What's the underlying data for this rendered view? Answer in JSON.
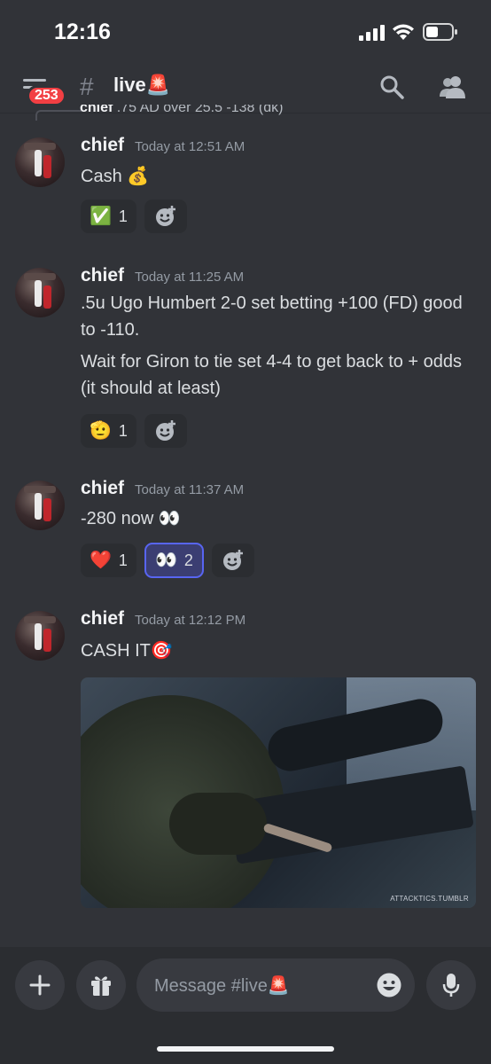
{
  "status_bar": {
    "time": "12:16"
  },
  "header": {
    "unread_badge": "253",
    "channel_name": "live🚨"
  },
  "reply_preview": {
    "author": "chief",
    "text": ".75 AD over 25.5 -138 (dk)"
  },
  "messages": [
    {
      "author": "chief",
      "timestamp": "Today at 12:51 AM",
      "lines": [
        "Cash 💰"
      ],
      "reactions": [
        {
          "emoji": "✅",
          "count": "1",
          "active": false
        }
      ]
    },
    {
      "author": "chief",
      "timestamp": "Today at 11:25 AM",
      "lines": [
        ".5u Ugo Humbert 2-0 set betting +100 (FD) good to -110.",
        "Wait for Giron to tie set 4-4 to get back to + odds (it should at least)"
      ],
      "reactions": [
        {
          "emoji": "🫡",
          "count": "1",
          "active": false
        }
      ]
    },
    {
      "author": "chief",
      "timestamp": "Today at 11:37 AM",
      "lines": [
        "-280 now 👀"
      ],
      "reactions": [
        {
          "emoji": "❤️",
          "count": "1",
          "active": false
        },
        {
          "emoji": "👀",
          "count": "2",
          "active": true
        }
      ]
    },
    {
      "author": "chief",
      "timestamp": "Today at 12:12 PM",
      "lines": [
        "CASH IT🎯"
      ],
      "attachment": {
        "type": "gif",
        "watermark": "ATTACKTICS.TUMBLR"
      }
    }
  ],
  "composer": {
    "placeholder": "Message #live🚨"
  },
  "colors": {
    "background": "#313338",
    "badge": "#f23f43",
    "accent": "#5865f2"
  }
}
